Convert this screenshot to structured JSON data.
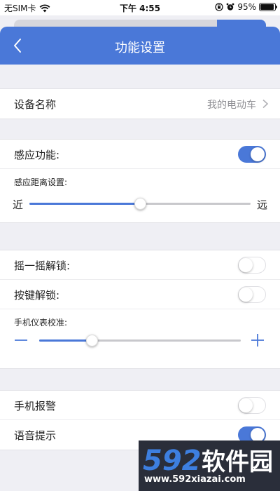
{
  "statusbar": {
    "carrier": "无SIM卡",
    "time": "下午 4:55",
    "battery": "95%",
    "battery_level": 0.95
  },
  "navbar": {
    "title": "功能设置"
  },
  "device": {
    "name_label": "设备名称",
    "name_value": "我的电动车"
  },
  "sensing": {
    "feature_label": "感应功能:",
    "feature_on": true,
    "distance_label": "感应距离设置:",
    "near_label": "近",
    "far_label": "远",
    "distance_level": 0.5
  },
  "unlock": {
    "shake_label": "摇一摇解锁:",
    "shake_on": false,
    "key_label": "按键解锁:",
    "key_on": false,
    "calib_label": "手机仪表校准:",
    "calib_level": 0.26
  },
  "alerts": {
    "alarm_label": "手机报警",
    "alarm_on": false,
    "voice_label": "语音提示",
    "voice_on": true
  },
  "watermark": {
    "brand": "592软件园",
    "url": "www.592xiazai.com"
  },
  "colors": {
    "accent": "#4a78d8",
    "background": "#efeff4"
  }
}
